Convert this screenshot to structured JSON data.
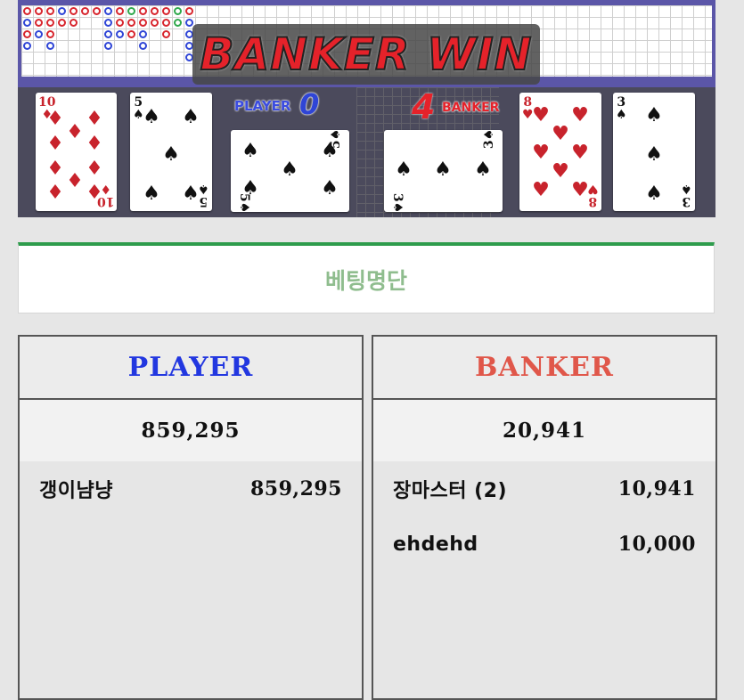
{
  "banner": {
    "result_text": "BANKER WIN"
  },
  "player_side": {
    "label": "PLAYER",
    "score": "0",
    "cards": [
      {
        "rank": "10",
        "suit": "♦",
        "color": "red"
      },
      {
        "rank": "5",
        "suit": "♠",
        "color": "black"
      },
      {
        "rank": "5",
        "suit": "♠",
        "color": "black",
        "rotated": true
      }
    ]
  },
  "banker_side": {
    "label": "BANKER",
    "score": "4",
    "cards": [
      {
        "rank": "3",
        "suit": "♠",
        "color": "black",
        "rotated": true
      },
      {
        "rank": "8",
        "suit": "♥",
        "color": "red"
      },
      {
        "rank": "3",
        "suit": "♠",
        "color": "black"
      }
    ]
  },
  "betting": {
    "title": "베팅명단",
    "player": {
      "label": "PLAYER",
      "color": "#2237e0",
      "total": "859,295",
      "rows": [
        {
          "name": "갱이냠냥",
          "amount": "859,295"
        }
      ]
    },
    "banker": {
      "label": "BANKER",
      "color": "#e0574a",
      "total": "20,941",
      "rows": [
        {
          "name": "장마스터 (2)",
          "amount": "10,941"
        },
        {
          "name": "ehdehd",
          "amount": "10,000"
        }
      ]
    }
  },
  "colors": {
    "score_player": "#2f45d6",
    "score_banker": "#e5222a",
    "header_accent": "#2e9c4c"
  }
}
